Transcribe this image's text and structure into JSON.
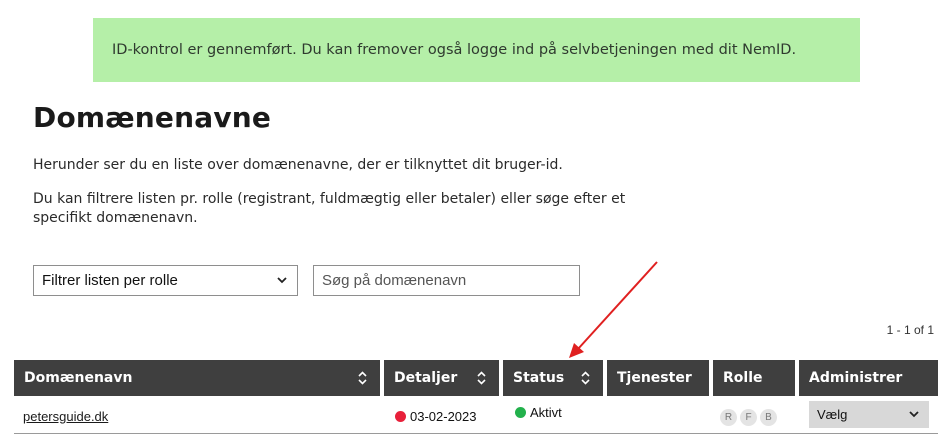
{
  "notice": {
    "text": "ID-kontrol er gennemført. Du kan fremover også logge ind på selvbetjeningen med dit NemID."
  },
  "page": {
    "title": "Domænenavne",
    "intro": "Herunder ser du en liste over domænenavne, der er tilknyttet dit bruger-id.",
    "filter_text": "Du kan filtrere listen pr. rolle (registrant, fuldmægtig eller betaler) eller søge efter et specifikt domænenavn."
  },
  "filters": {
    "role_select_value": "Filtrer listen per rolle",
    "search_placeholder": "Søg på domænenavn"
  },
  "pager": {
    "text": "1 - 1 of 1"
  },
  "table": {
    "headers": {
      "domain": "Domænenavn",
      "details": "Detaljer",
      "status": "Status",
      "services": "Tjenester",
      "role": "Rolle",
      "admin": "Administrer"
    },
    "rows": [
      {
        "domain": "petersguide.dk",
        "details_date": "03-02-2023",
        "details_color": "#e8203a",
        "status": "Aktivt",
        "status_color": "#22b14c",
        "roles": [
          "R",
          "F",
          "B"
        ],
        "admin_value": "Vælg"
      }
    ]
  },
  "colors": {
    "notice_bg": "#b5efa8",
    "header_bg": "#3f3f3f",
    "annotation_arrow": "#e02020"
  }
}
